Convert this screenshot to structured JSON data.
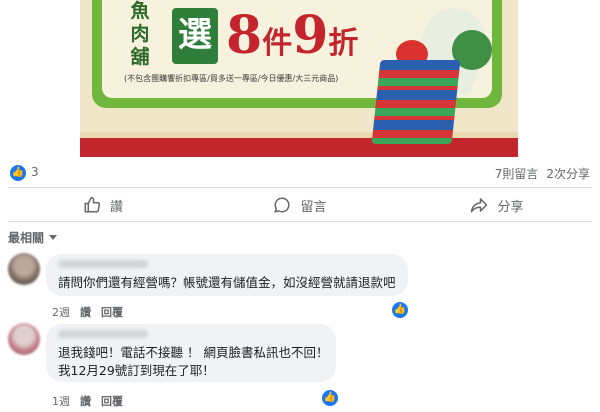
{
  "banner": {
    "vertical_text": [
      "魚",
      "肉",
      "舖"
    ],
    "highlight_char": "選",
    "headline_number1": "8",
    "headline_word1": "件",
    "headline_number2": "9",
    "headline_word2": "折",
    "fine_print": "(不包含團購饗折扣專區/買多送一專區/今日優惠/大三元商品)",
    "colors": {
      "green": "#6fb63c",
      "red": "#c4242b",
      "cream": "#f7f2dd"
    }
  },
  "stats": {
    "like_count": "3",
    "comments": "7則留言",
    "shares": "2次分享"
  },
  "actions": {
    "like_label": "讚",
    "comment_label": "留言",
    "share_label": "分享"
  },
  "sort": {
    "label": "最相關"
  },
  "comments": [
    {
      "text_lines": [
        "請問你們還有經營嗎？帳號還有儲值金，如沒經營就請退款吧"
      ],
      "time": "2週",
      "like": "讚",
      "reply": "回覆"
    },
    {
      "text_lines": [
        "退我錢吧！電話不接聽 ！ 網頁臉書私訊也不回！",
        "我12月29號訂到現在了耶！"
      ],
      "time": "1週",
      "like": "讚",
      "reply": "回覆"
    }
  ],
  "accent_color": "#1877f2"
}
